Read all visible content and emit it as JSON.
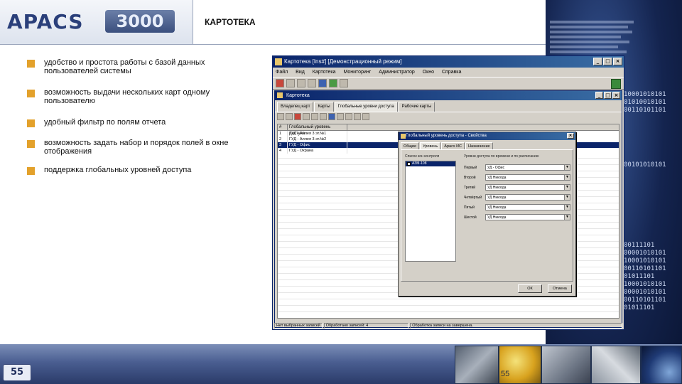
{
  "slide": {
    "logo_word": "APACS",
    "logo_number": "3000",
    "title": "КАРТОТЕКА",
    "page_number": "55",
    "page_number_ghost": "55",
    "bullets": [
      "удобство и простота работы с базой данных пользователей системы",
      "возможность выдачи нескольких карт одному пользователю",
      "удобный фильтр по полям отчета",
      "возможность задать набор и порядок полей в окне отображения",
      "поддержка глобальных уровней доступа"
    ],
    "binary_top": "10001010101\n01010010101\n00110101101\n\n\n\n\n\n\n00101010101\n\n",
    "binary_bottom": "00111101\n00001010101\n10001010101\n00110101101\n01011101\n10001010101\n00001010101\n00110101101\n01011101",
    "colors": {
      "bullet": "#e3a12b",
      "titlebar": "#0a246a",
      "slide_bar": "#4a5e91"
    }
  },
  "app": {
    "title": "Картотека [Ins#] [Демонстрационный режим]",
    "menu": [
      "Файл",
      "Вид",
      "Картотека",
      "Мониторинг",
      "Администратор",
      "Окно",
      "Справка"
    ],
    "child_title": "Картотека",
    "tabs": [
      "Владелец карт",
      "Карты",
      "Глобальные уровни доступа",
      "Рабочие карты"
    ],
    "grid": {
      "headers": [
        "#",
        "Глобальный уровень доступа"
      ],
      "rows": [
        {
          "num": "1",
          "name": "ГУД - Аллея 3 эт.№1",
          "selected": false
        },
        {
          "num": "2",
          "name": "ГУД - Аллея 3 эт.№2",
          "selected": false
        },
        {
          "num": "3",
          "name": "ГУД - Офис",
          "selected": true
        },
        {
          "num": "4",
          "name": "ГУД - Охрана",
          "selected": false
        }
      ]
    },
    "status": [
      "Нет выбранных записей",
      "Обработано записей: 4",
      "Обработка записи на завершена."
    ]
  },
  "dialog": {
    "title": "Глобальный уровень доступа - Свойства",
    "tabs": [
      "Общие",
      "Уровень",
      "Apaсs ИС",
      "Назначение"
    ],
    "list_caption": "Список зон контроля",
    "list_item": "АЗМ-108",
    "schedule_caption": "Уровни доступа по времени и по расписанию",
    "rows": [
      {
        "label": "Первый",
        "value": "УД - Офис"
      },
      {
        "label": "Второй",
        "value": "УД Никогда"
      },
      {
        "label": "Третий",
        "value": "УД Никогда"
      },
      {
        "label": "Четвёртый",
        "value": "УД Никогда"
      },
      {
        "label": "Пятый",
        "value": "УД Никогда"
      },
      {
        "label": "Шестой",
        "value": "УД Никогда"
      }
    ],
    "ok_label": "ОК",
    "cancel_label": "Отмена"
  }
}
